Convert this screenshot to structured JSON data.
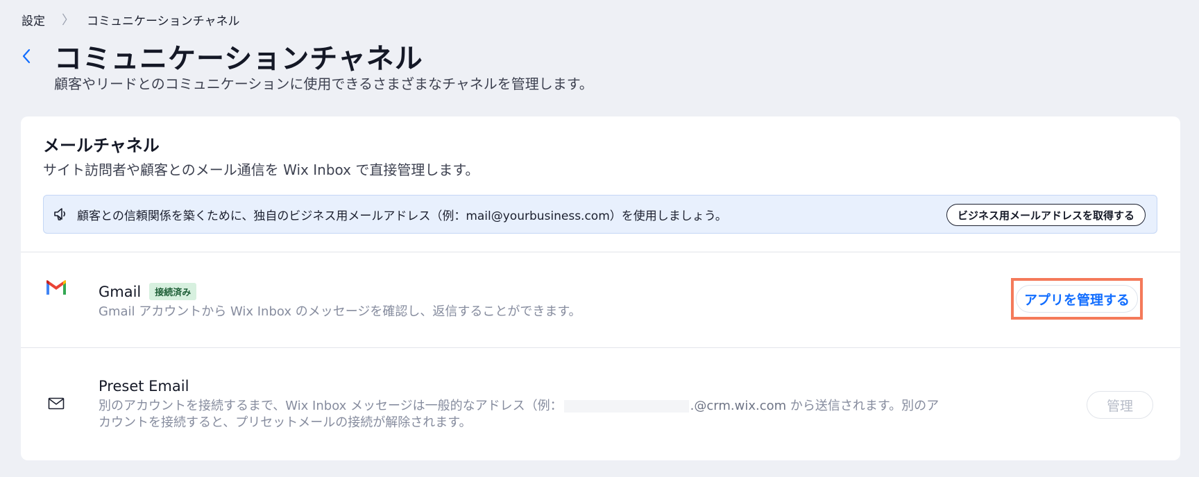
{
  "breadcrumb": {
    "root": "設定",
    "separator": "〉",
    "current": "コミュニケーションチャネル"
  },
  "header": {
    "back_icon": "chevron-left-icon",
    "title": "コミュニケーションチャネル",
    "subtitle": "顧客やリードとのコミュニケーションに使用できるさまざまなチャネルを管理します。"
  },
  "email_channels": {
    "title": "メールチャネル",
    "subtitle": "サイト訪問者や顧客とのメール通信を Wix Inbox で直接管理します。",
    "banner": {
      "icon": "megaphone-icon",
      "text": "顧客との信頼関係を築くために、独自のビジネス用メールアドレス（例：mail@yourbusiness.com）を使用しましょう。",
      "button_label": "ビジネス用メールアドレスを取得する"
    },
    "channels": [
      {
        "icon": "gmail-icon",
        "name": "Gmail",
        "status": "接続済み",
        "description": "Gmail アカウントから Wix Inbox のメッセージを確認し、返信することができます。",
        "button_label": "アプリを管理する"
      },
      {
        "icon": "envelope-icon",
        "name": "Preset Email",
        "description_before": "別のアカウントを接続するまで、Wix Inbox メッセージは一般的なアドレス（例：",
        "description_email_domain": ".@crm.wix.com",
        "description_after": " から送信されます。別のア",
        "description_line2": "カウントを接続すると、プリセットメールの接続が解除されます。",
        "button_label": "管理"
      }
    ]
  },
  "colors": {
    "accent": "#116dff",
    "page_background": "#eef0f5",
    "highlight": "#f47a5a",
    "badge_bg": "#d7f0df",
    "badge_text": "#1d5d36"
  }
}
